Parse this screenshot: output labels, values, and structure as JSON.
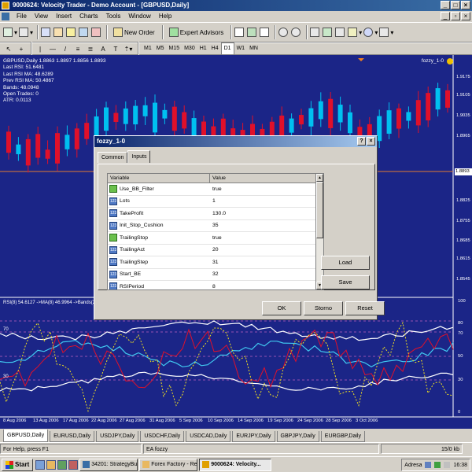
{
  "window": {
    "title": "9000624: Velocity Trader - Demo Account - [GBPUSD,Daily]"
  },
  "menu": [
    "File",
    "View",
    "Insert",
    "Charts",
    "Tools",
    "Window",
    "Help"
  ],
  "toolbar": {
    "new_order": "New Order",
    "expert_advisors": "Expert Advisors"
  },
  "timeframes": [
    "M1",
    "M5",
    "M15",
    "M30",
    "H1",
    "H4",
    "D1",
    "W1",
    "MN"
  ],
  "active_timeframe": "D1",
  "chart": {
    "symbol_line": "GBPUSD,Daily  1.8863 1.8897 1.8856 1.8893",
    "info_lines": [
      "Last RSI: 51.6481",
      "Last RSI MA: 48.6289",
      "Prev RSI MA: 50.4867",
      "Bands: 48.0948",
      "Open Trades: 0",
      "ATR: 0.0113"
    ],
    "ea_name": "fozzy_1-0",
    "price_ticks": [
      "1.9175",
      "1.9105",
      "1.9035",
      "1.8965",
      "1.8825",
      "1.8755",
      "1.8685",
      "1.8615",
      "1.8545"
    ],
    "current_price": "1.8893",
    "rsi_label": "RSI(8) 54.6127  ->MA(8) 46.9964  ->Bands(2",
    "rsi_ticks": [
      "100",
      "80",
      "70",
      "50",
      "30",
      "0"
    ],
    "rsi_levels": [
      "80",
      "70",
      "50",
      "30"
    ],
    "dates": [
      "8 Aug 2006",
      "13 Aug 2006",
      "17 Aug 2006",
      "22 Aug 2006",
      "27 Aug 2006",
      "31 Aug 2006",
      "5 Sep 2006",
      "10 Sep 2006",
      "14 Sep 2006",
      "19 Sep 2006",
      "24 Sep 2006",
      "28 Sep 2006",
      "3 Oct 2006"
    ],
    "colors": {
      "bg": "#1b2587",
      "bull": "#00c0f0",
      "bear": "#e0102a",
      "rsi": "#e0102a",
      "ma": "#40c8f0",
      "bands": "#ffffff",
      "dotted": "#f0e020"
    }
  },
  "tabs": [
    "GBPUSD,Daily",
    "EURUSD,Daily",
    "USDJPY,Daily",
    "USDCHF,Daily",
    "USDCAD,Daily",
    "EURJPY,Daily",
    "GBPJPY,Daily",
    "EURGBP,Daily"
  ],
  "active_tab": "GBPUSD,Daily",
  "status": {
    "help": "For Help, press F1",
    "ea": "EA fozzy",
    "traffic": "15/0 kb"
  },
  "taskbar": {
    "start": "Start",
    "tasks": [
      "34201: StrategyBuilder...",
      "Forex Factory - Reply t...",
      "9000624: Velocity..."
    ],
    "tray": "Adresa",
    "time": "16:38"
  },
  "dialog": {
    "title": "fozzy_1-0",
    "tabs": [
      "Common",
      "Inputs"
    ],
    "active_tab": "Inputs",
    "columns": [
      "Variable",
      "Value"
    ],
    "rows": [
      {
        "type": "bool",
        "name": "Use_BB_Filter",
        "value": "true"
      },
      {
        "type": "num",
        "name": "Lots",
        "value": "1"
      },
      {
        "type": "num",
        "name": "TakeProfit",
        "value": "130.0"
      },
      {
        "type": "num",
        "name": "Init_Stop_Cushion",
        "value": "35"
      },
      {
        "type": "bool",
        "name": "TrailingStop",
        "value": "true"
      },
      {
        "type": "num",
        "name": "TrailingAct",
        "value": "20"
      },
      {
        "type": "num",
        "name": "TrailingStep",
        "value": "31"
      },
      {
        "type": "num",
        "name": "Start_BE",
        "value": "32"
      },
      {
        "type": "num",
        "name": "RSIPeriod",
        "value": "8"
      }
    ],
    "buttons": {
      "load": "Load",
      "save": "Save",
      "ok": "OK",
      "cancel": "Storno",
      "reset": "Reset"
    }
  }
}
